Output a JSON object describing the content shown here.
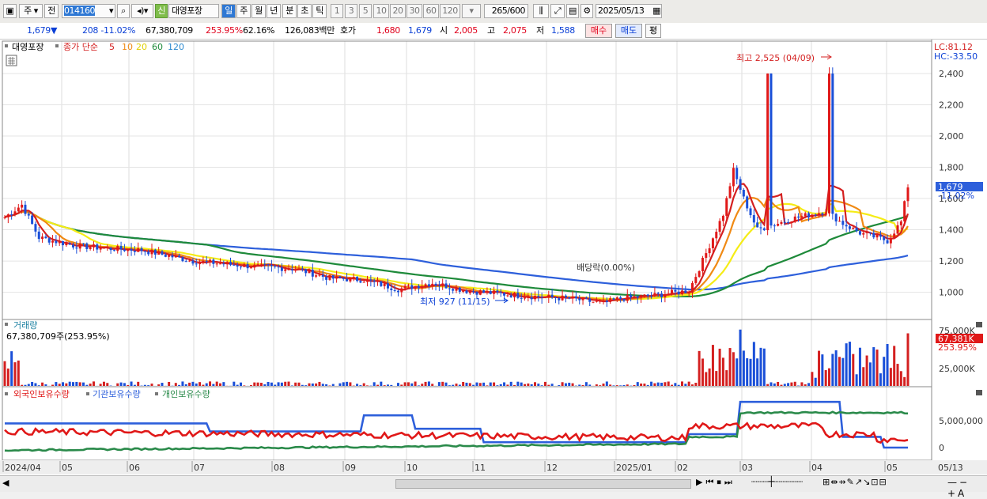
{
  "toolbar": {
    "type1": "주",
    "type2": "전",
    "code": "014160",
    "badge": "신",
    "name": "대영포장",
    "periods": [
      "일",
      "주",
      "월",
      "년",
      "분",
      "초",
      "틱"
    ],
    "numbers": [
      "1",
      "3",
      "5",
      "10",
      "20",
      "30",
      "60",
      "120"
    ],
    "count": "265",
    "count_max": "/600",
    "date": "2025/05/13"
  },
  "quote": {
    "price": "1,679",
    "arrow": "▼",
    "change": "208",
    "change_pct": "-11.02%",
    "volume": "67,380,709",
    "volume_ratio": "253.95%",
    "turnover": "62.16%",
    "amount": "126,083백만",
    "ask_label": "호가",
    "ask1": "1,680",
    "ask2": "1,679",
    "open_label": "시",
    "open": "2,005",
    "high_label": "고",
    "high": "2,075",
    "low_label": "저",
    "low": "1,588",
    "buy": "매수",
    "sell": "매도",
    "avg": "평"
  },
  "price_panel": {
    "stock_label": "대영포장",
    "legend_title": "종가 단순",
    "ma_labels": [
      "5",
      "10",
      "20",
      "60",
      "120"
    ],
    "ma_colors": [
      "#d42020",
      "#f08a14",
      "#f5ec16",
      "#1e8a3a",
      "#2d5fdb"
    ],
    "lc_label": "LC:81.12",
    "hc_label": "HC:-33.50",
    "price_tag": "1,679",
    "price_tag_pct": "-11.02%",
    "high_marker": "최고 2,525 (04/09)",
    "low_marker": "최저 927 (11/15)",
    "dividend_marker": "배당락(0.00%)",
    "y_axis": [
      "2,400",
      "2,200",
      "2,000",
      "1,800",
      "1,600",
      "1,400",
      "1,200",
      "1,000"
    ]
  },
  "volume_panel": {
    "title": "거래량",
    "info": "67,380,709주(253.95%)",
    "y_axis": [
      "75,000K",
      "25,000K"
    ],
    "tag": "67,381K",
    "tag_pct": "253.95%"
  },
  "holdings_panel": {
    "legend": [
      "외국인보유수량",
      "기관보유수량",
      "개인보유수량"
    ],
    "legend_colors": [
      "#e01818",
      "#2d5fdb",
      "#2a8a4a"
    ],
    "y_axis": [
      "5,000,000",
      "0"
    ]
  },
  "x_axis": [
    "2024/04",
    "05",
    "06",
    "07",
    "08",
    "09",
    "10",
    "11",
    "12",
    "2025/01",
    "02",
    "03",
    "04",
    "05",
    "05/13"
  ]
}
